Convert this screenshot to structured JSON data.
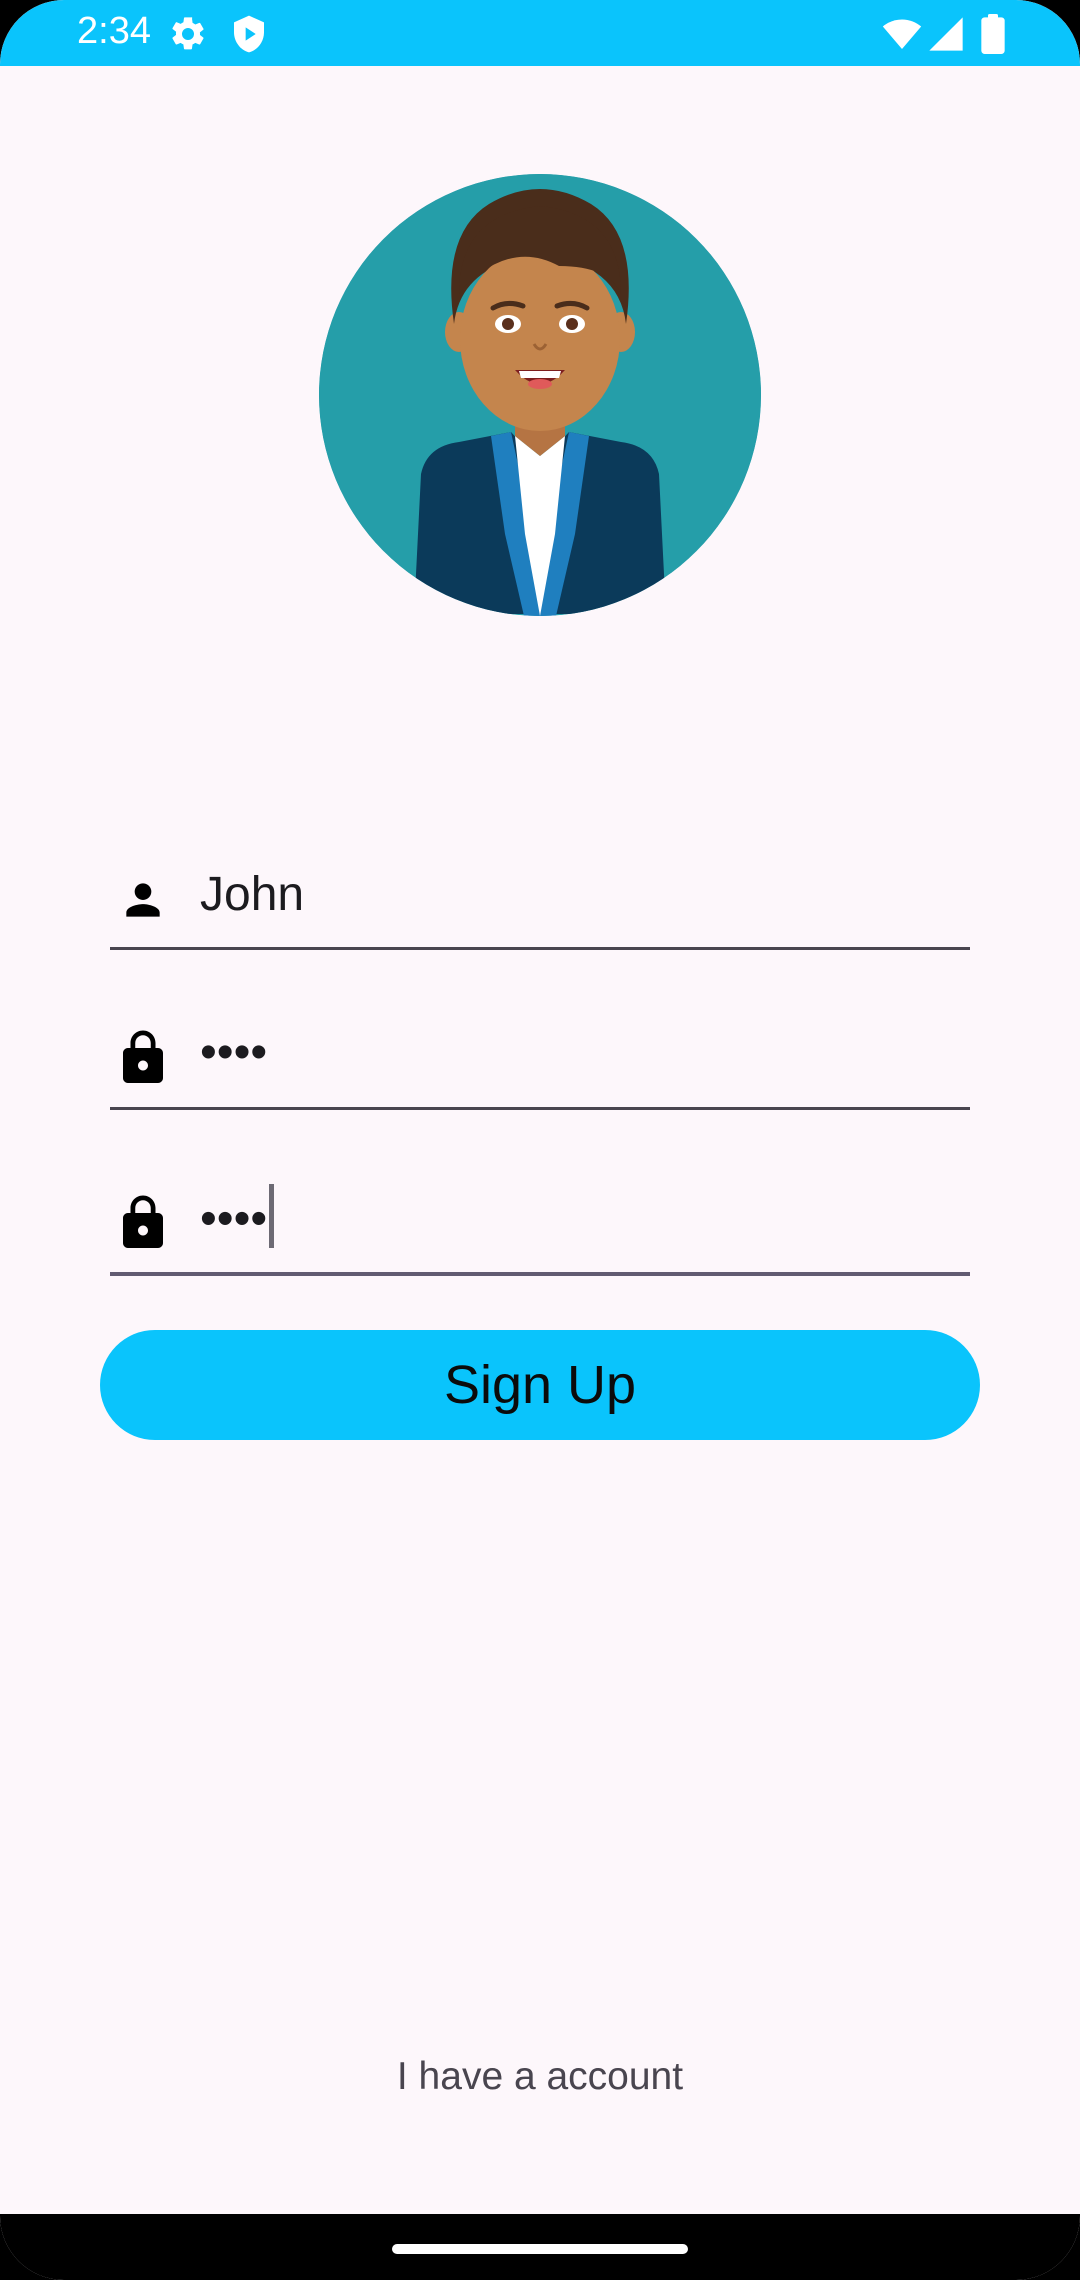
{
  "status_bar": {
    "time": "2:34",
    "icons": [
      "gear-icon",
      "shield-play-icon",
      "wifi-icon",
      "cellular-signal-icon",
      "battery-icon"
    ],
    "background": "#0ac4fc"
  },
  "avatar": {
    "icon": "user-avatar-illustration",
    "background": "#259ea9"
  },
  "form": {
    "username": {
      "icon": "person-icon",
      "value": "John"
    },
    "password": {
      "icon": "lock-icon",
      "value": "••••"
    },
    "confirm_password": {
      "icon": "lock-icon",
      "value": "••••",
      "focused": true
    },
    "signup_label": "Sign Up",
    "accent_color": "#0ac4fc"
  },
  "footer": {
    "account_link": "I have a account"
  }
}
